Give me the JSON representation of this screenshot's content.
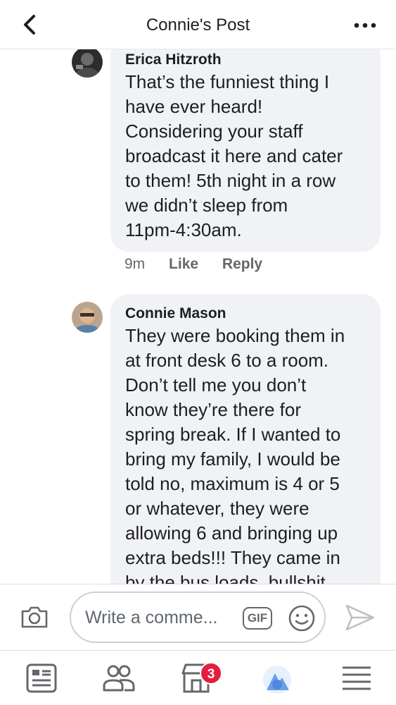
{
  "header": {
    "title": "Connie's Post",
    "back_icon": "chevron-left-icon",
    "more_icon": "more-horizontal-icon"
  },
  "comments": [
    {
      "author": "Erica Hitzroth",
      "text": "That’s the funniest thing I\nhave ever heard!\nConsidering your staff\nbroadcast it here and cater\nto them! 5th night in a row\nwe didn’t sleep from\n11pm-4:30am.",
      "time": "9m",
      "like_label": "Like",
      "reply_label": "Reply"
    },
    {
      "author": "Connie Mason",
      "text": "They were booking them in\nat front desk 6 to a room.\nDon’t tell me you don’t\nknow they’re there for\nspring break. If I wanted to\nbring my family, I would be\ntold no, maximum is 4 or 5\nor whatever, they were\nallowing 6 and bringing up\nextra beds!!! They came in\nby the bus loads, bullshit"
    }
  ],
  "composer": {
    "placeholder": "Write a comme...",
    "gif_label": "GIF"
  },
  "tabbar": {
    "marketplace_badge": "3"
  },
  "colors": {
    "bubble": "#f0f2f5",
    "badge": "#e41e3f",
    "meta_text": "#65676b"
  }
}
